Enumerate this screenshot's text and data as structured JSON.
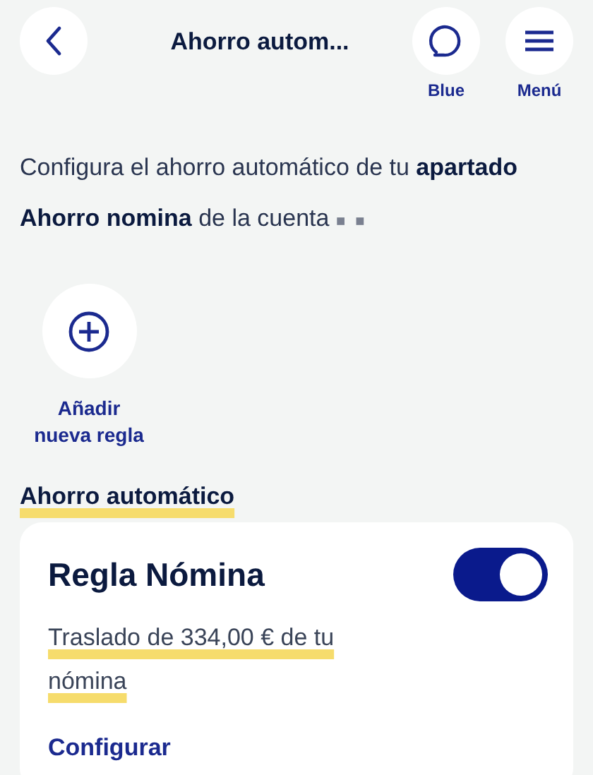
{
  "header": {
    "title": "Ahorro autom...",
    "actions": [
      {
        "kind": "chat",
        "label": "Blue"
      },
      {
        "kind": "menu",
        "label": "Menú"
      }
    ]
  },
  "intro": {
    "text": "Configura el ahorro automático de tu **apartado Ahorro nomina** de la cuenta",
    "account_mask": "■ ■"
  },
  "add_rule": {
    "label": "Añadir nueva regla"
  },
  "section": {
    "title": "Ahorro automático",
    "highlighted": true
  },
  "rules": [
    {
      "title": "Regla Nómina",
      "on": true,
      "description": "Traslado de 334,00 € de tu nómina",
      "highlighted": true,
      "action": "Configurar"
    }
  ]
}
